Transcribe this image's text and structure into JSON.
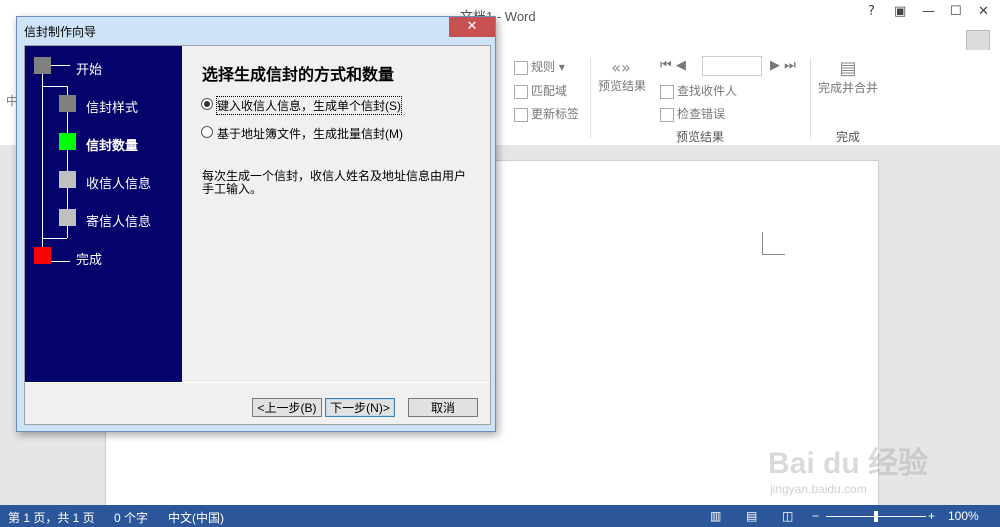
{
  "word": {
    "title": "文档1 - Word",
    "window_controls": [
      "?",
      "▣",
      "—",
      "☐",
      "✕"
    ],
    "ribbon": {
      "rules_label": "规则",
      "match_fields_label": "匹配域",
      "update_labels_label": "更新标签",
      "preview_results_button": "预览结果",
      "find_recipient_label": "查找收件人",
      "check_errors_label": "检查错误",
      "preview_results_group": "预览结果",
      "finish_merge_button": "完成并合并",
      "finish_group": "完成",
      "left_partial_label": "中"
    }
  },
  "dialog": {
    "title": "信封制作向导",
    "nav_steps": [
      {
        "label": "开始",
        "color": "#808080"
      },
      {
        "label": "信封样式",
        "color": "#808080"
      },
      {
        "label": "信封数量",
        "color": "#00ff00",
        "active": true
      },
      {
        "label": "收信人信息",
        "color": "#c0c0c0"
      },
      {
        "label": "寄信人信息",
        "color": "#c0c0c0"
      },
      {
        "label": "完成",
        "color": "#ff0000"
      }
    ],
    "heading": "选择生成信封的方式和数量",
    "options": [
      {
        "label": "键入收信人信息，生成单个信封(S)",
        "checked": true
      },
      {
        "label": "基于地址簿文件，生成批量信封(M)",
        "checked": false
      }
    ],
    "description": "每次生成一个信封，收信人姓名及地址信息由用户手工输入。",
    "buttons": {
      "prev": "<上一步(B)",
      "next": "下一步(N)>",
      "cancel": "取消"
    }
  },
  "statusbar": {
    "page": "第 1 页，共 1 页",
    "words": "0 个字",
    "language": "中文(中国)",
    "zoom": "100%",
    "zoom_level": 1.0
  },
  "watermark": {
    "brand": "Bai du 经验",
    "url": "jingyan.baidu.com"
  }
}
